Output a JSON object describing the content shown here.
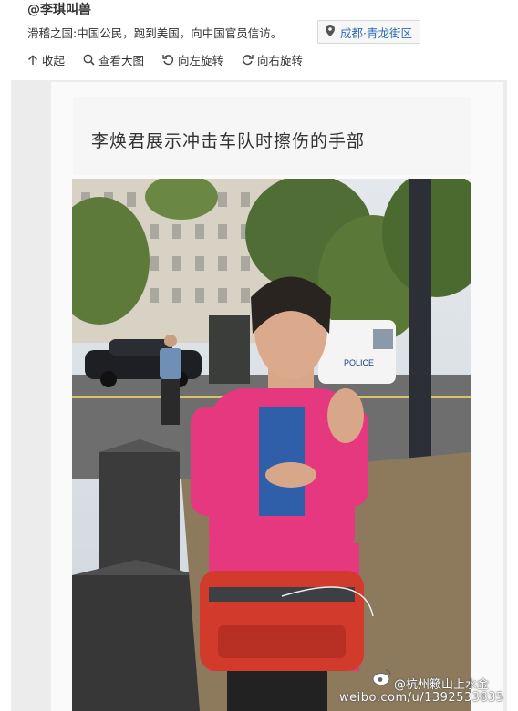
{
  "post": {
    "username": "@李琪叫兽",
    "text": "滑稽之国:中国公民，跑到美国，向中国官员信访。",
    "location": "成都·青龙街区"
  },
  "toolbar": {
    "collapse": "收起",
    "view_large": "查看大图",
    "rotate_left": "向左旋转",
    "rotate_right": "向右旋转"
  },
  "image": {
    "caption": "李焕君展示冲击车队时擦伤的手部",
    "watermark_line1": "@杭州籁山上水金",
    "watermark_line2": "weibo.com/u/1392533835",
    "sign_text": "POLICE"
  },
  "icons": {
    "location": "map-pin-icon",
    "collapse": "arrow-up-icon",
    "view_large": "search-icon",
    "rotate_left": "rotate-left-icon",
    "rotate_right": "rotate-right-icon",
    "watermark_logo": "weibo-logo-icon"
  },
  "colors": {
    "link": "#2d6bb3",
    "jacket": "#e5387e",
    "bag": "#d23a2c"
  }
}
